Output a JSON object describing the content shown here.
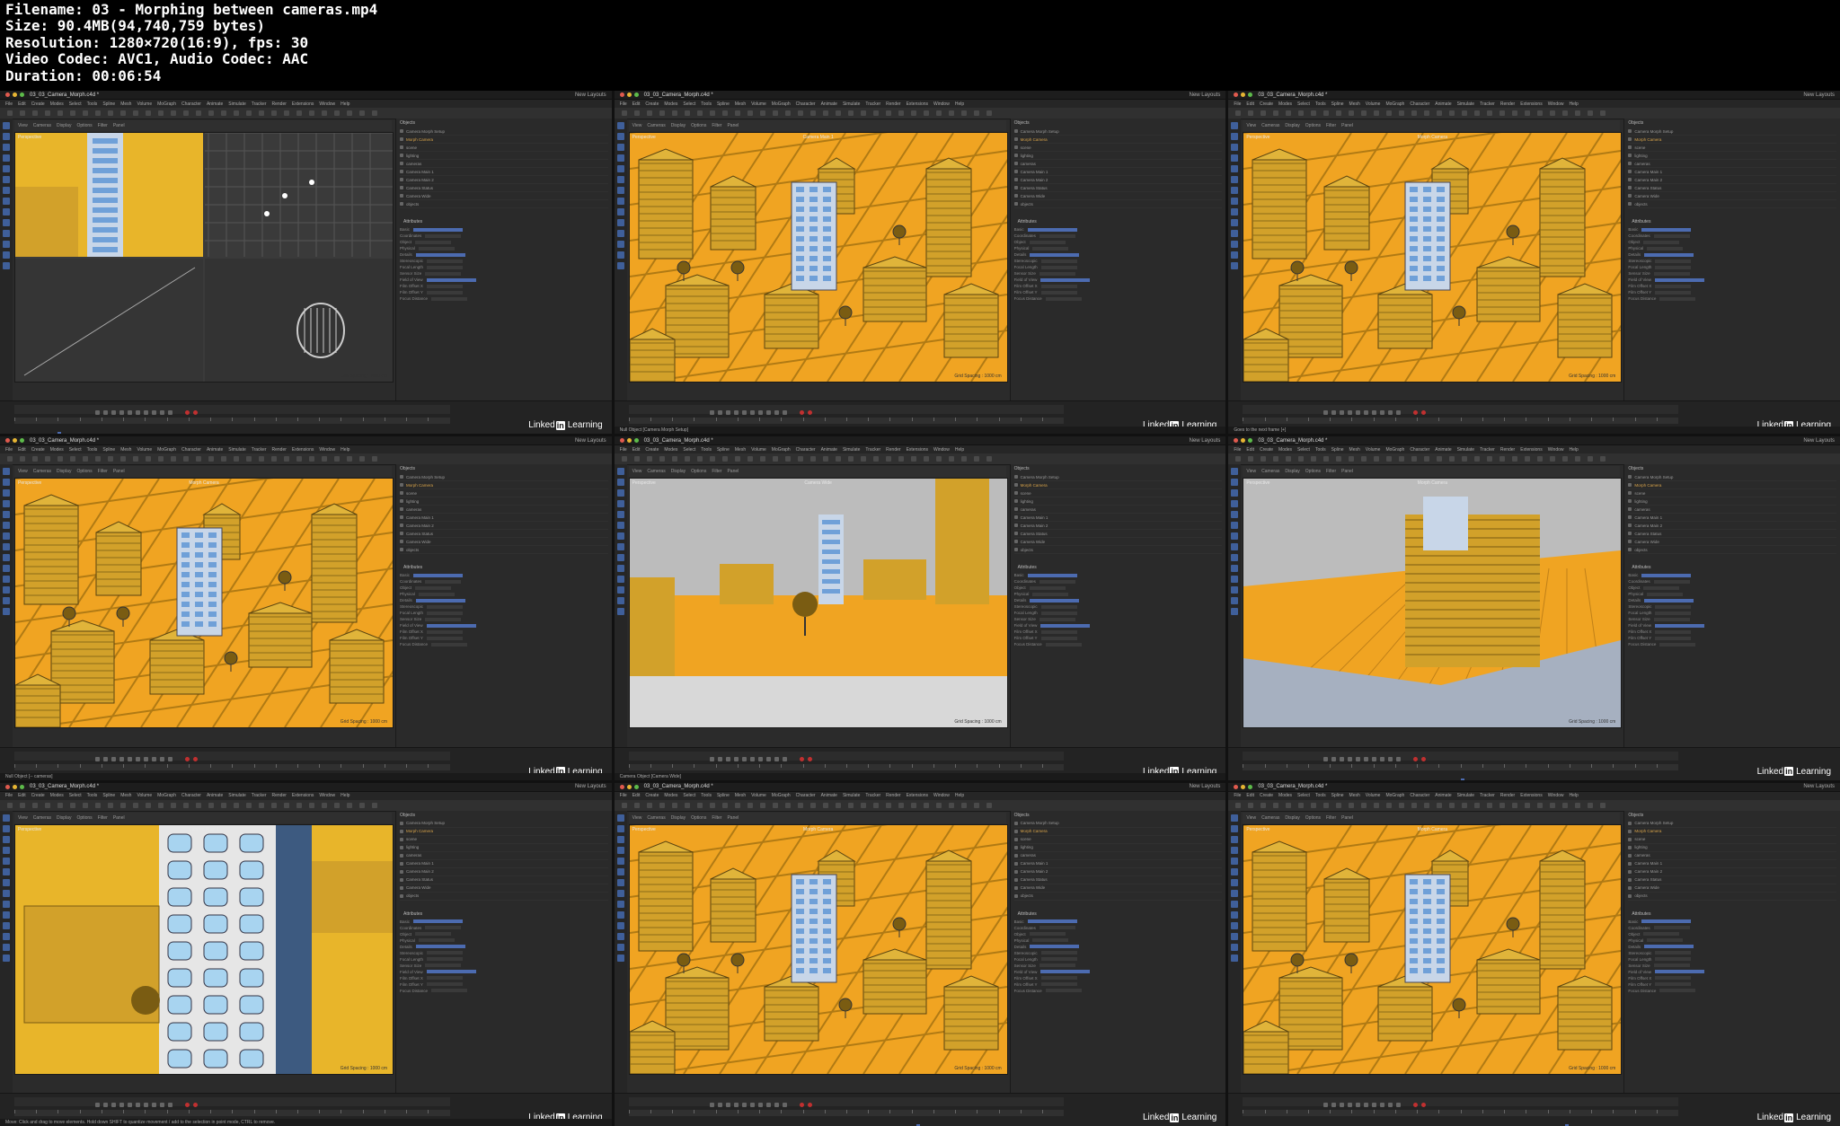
{
  "header": {
    "filename": "Filename: 03 - Morphing between cameras.mp4",
    "size": "Size: 90.4MB(94,740,759 bytes)",
    "resolution": "Resolution: 1280×720(16:9), fps: 30",
    "codec": "Video Codec: AVC1, Audio Codec: AAC",
    "duration": "Duration: 00:06:54"
  },
  "app": {
    "file_name": "03_03_Camera_Morph.c4d *",
    "layout_label": "New Layouts",
    "menu": [
      "File",
      "Edit",
      "Create",
      "Modes",
      "Select",
      "Tools",
      "Spline",
      "Mesh",
      "Volume",
      "MoGraph",
      "Character",
      "Animate",
      "Simulate",
      "Tracker",
      "Render",
      "Extensions",
      "Window",
      "Help"
    ],
    "viewport_menu": [
      "View",
      "Cameras",
      "Display",
      "Options",
      "Filter",
      "Panel"
    ],
    "perspective_label": "Perspective",
    "grid_spacing": "Grid Spacing : 1000 cm",
    "brand_pre": "Linked",
    "brand_in": "in",
    "brand_post": " Learning",
    "objects_tab": "Objects",
    "attributes_tab": "Attributes"
  },
  "tiles": [
    {
      "cam": "",
      "status": "",
      "scene": "quad",
      "tree_title": "Objects"
    },
    {
      "cam": "Camera Main 1",
      "status": "Null Object [Camera Morph Setup]",
      "scene": "city1",
      "tree_title": "Objects"
    },
    {
      "cam": "Morph Camera",
      "status": "Goes to the next frame [+]",
      "scene": "city2",
      "tree_title": "Objects"
    },
    {
      "cam": "Morph Camera",
      "status": "Null Object [-- cameras]",
      "scene": "city3",
      "tree_title": "Objects"
    },
    {
      "cam": "Camera Wide",
      "status": "Camera Object [Camera Wide]",
      "scene": "wide",
      "tree_title": "Objects"
    },
    {
      "cam": "Morph Camera",
      "status": "",
      "scene": "close",
      "tree_title": "Objects"
    },
    {
      "cam": "Camera Main 1",
      "status": "Move: Click and drag to move elements. Hold down SHIFT to quantize movement / add to the selection in point mode, CTRL to remove.",
      "scene": "tower",
      "tree_title": "Objects"
    },
    {
      "cam": "Morph Camera",
      "status": "",
      "scene": "city4",
      "tree_title": "Objects"
    },
    {
      "cam": "Morph Camera",
      "status": "",
      "scene": "city5",
      "tree_title": "Objects"
    }
  ],
  "tree_items": [
    "Camera Morph Setup",
    "Morph Camera",
    "scene",
    "lighting",
    "cameras",
    "Camera Main 1",
    "Camera Main 2",
    "Camera Status",
    "Camera Wide",
    "objects"
  ],
  "attr_labels": [
    "Basic",
    "Coordinates",
    "Object",
    "Physical",
    "Details",
    "Stereoscopic",
    "Focal Length",
    "Sensor Size",
    "Field of View",
    "Film Offset X",
    "Film Offset Y",
    "Focus Distance"
  ],
  "colors": {
    "sky": "#e8b52a",
    "ground": "#f0a422",
    "building": "#d2a12a",
    "building_dark": "#7a5c12",
    "tower": "#c8d6e8",
    "accent": "#4c6bb0"
  }
}
